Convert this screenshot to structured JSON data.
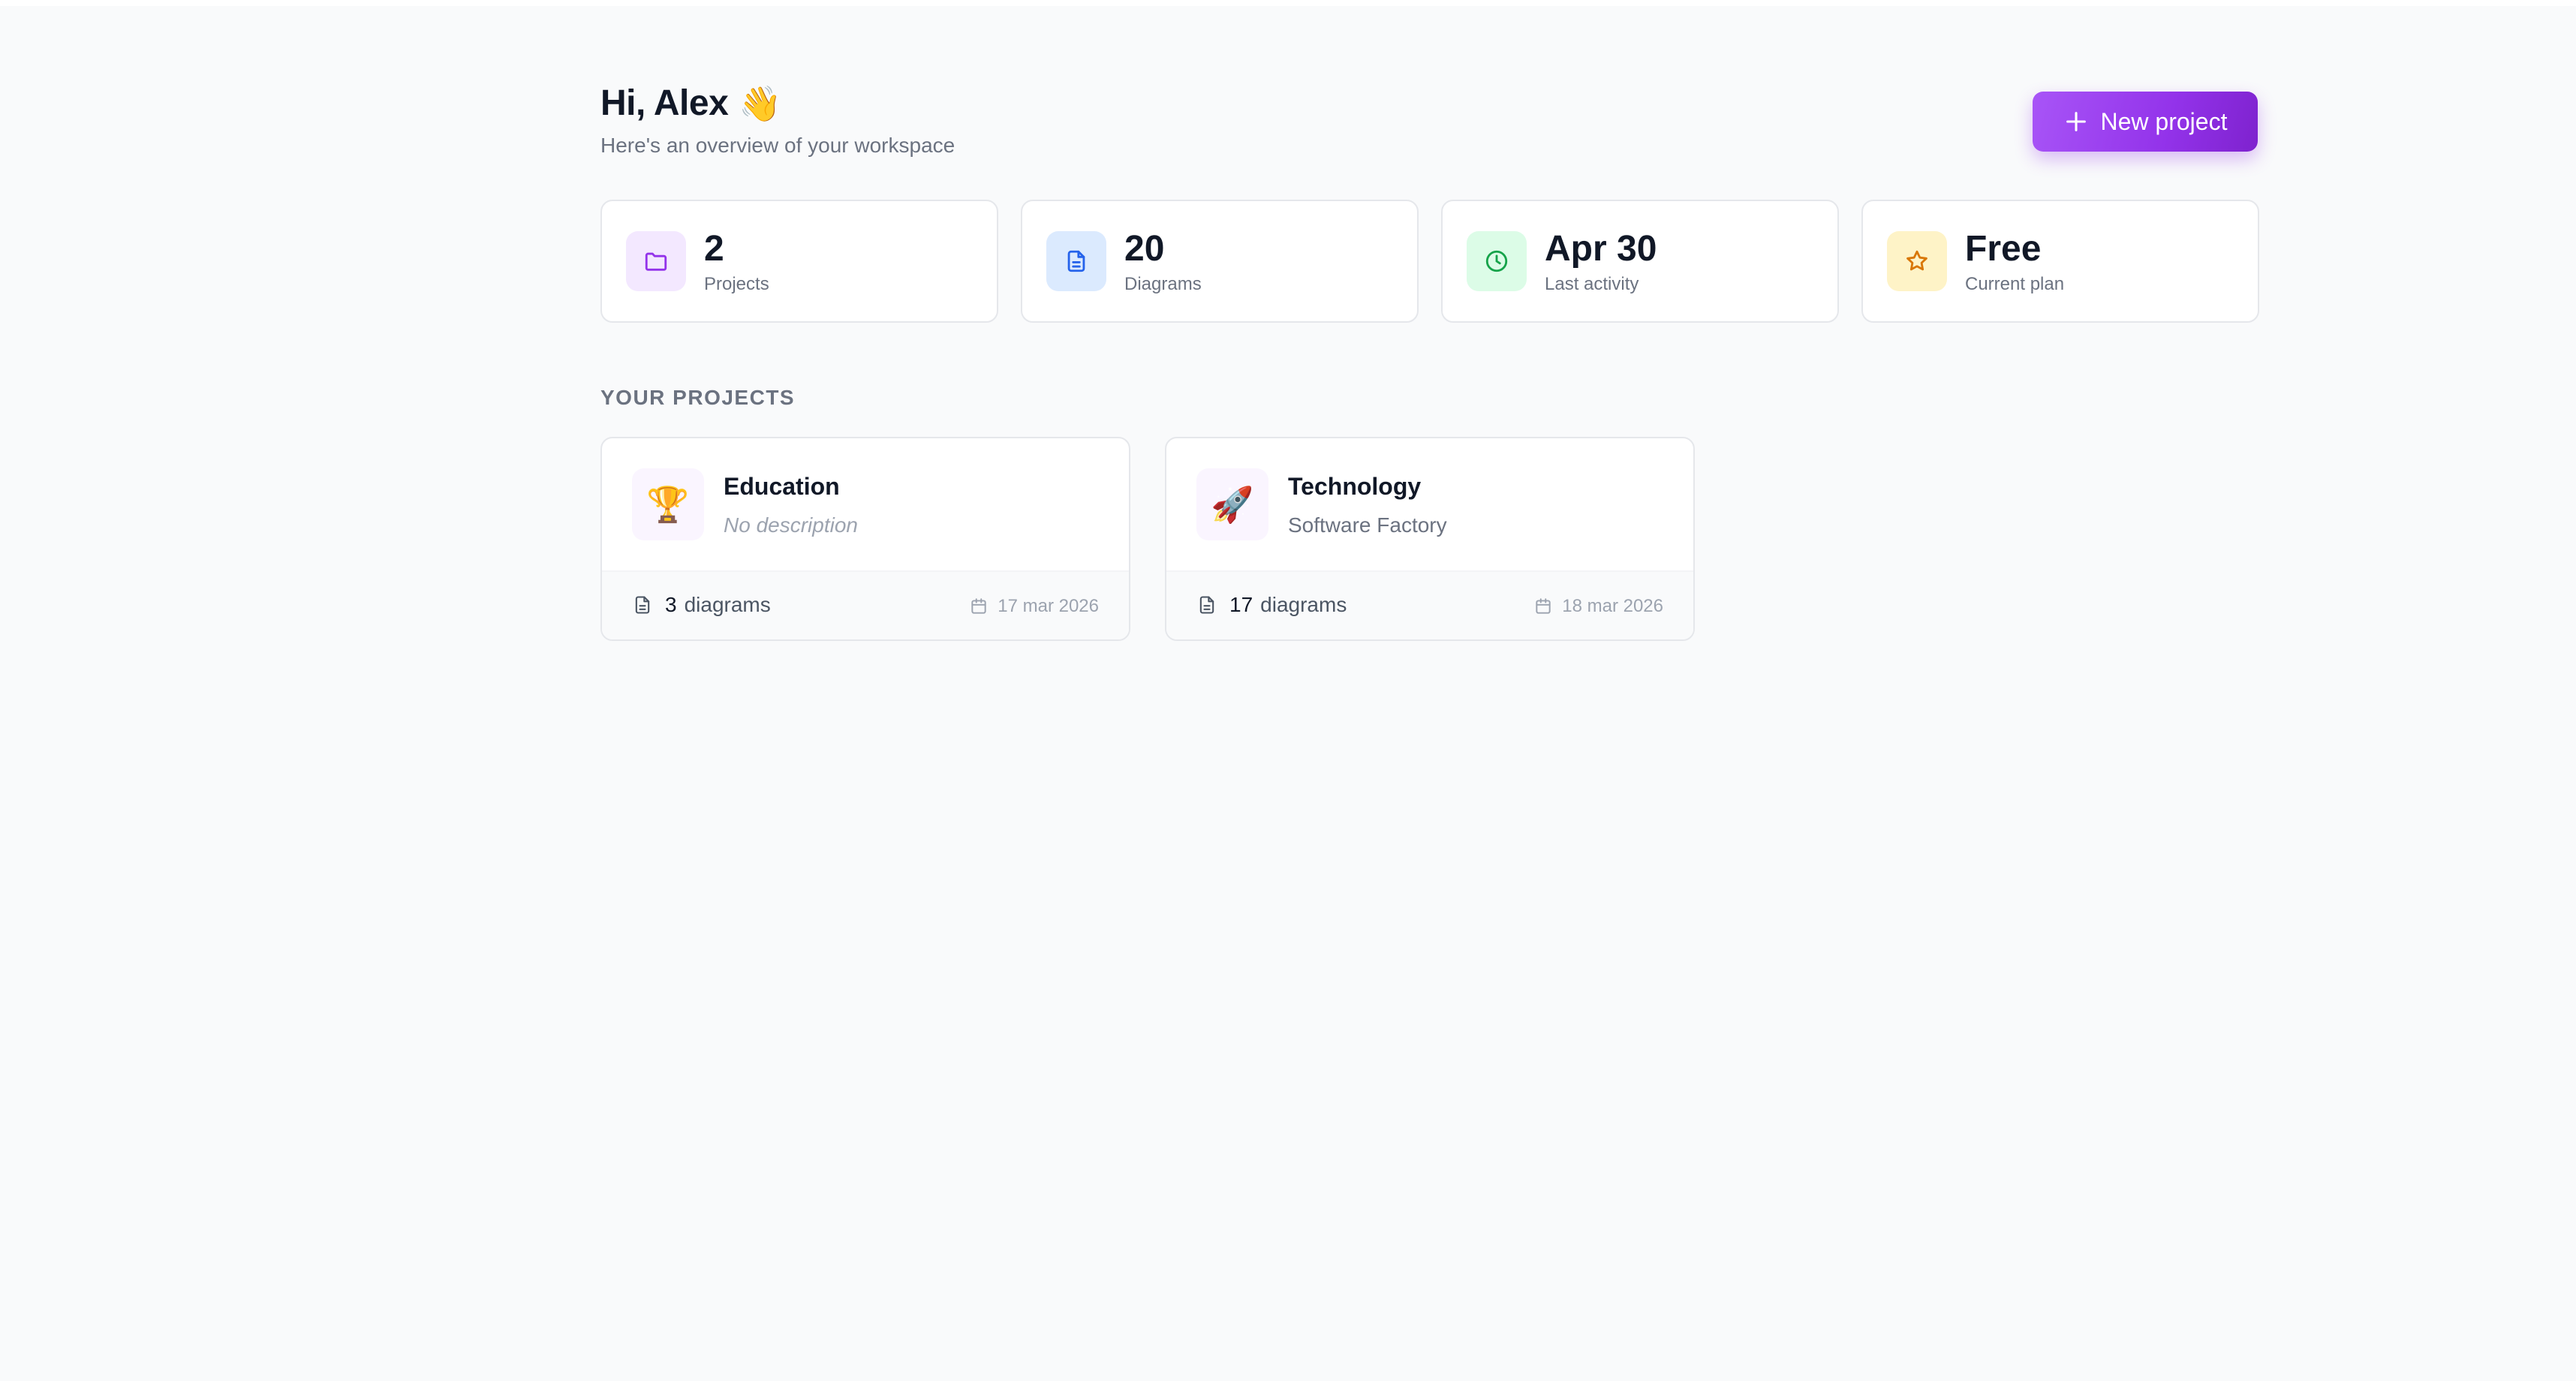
{
  "header": {
    "greeting": "Hi, Alex",
    "wave_emoji": "👋",
    "subtitle": "Here's an overview of your workspace",
    "new_project_label": "New project"
  },
  "stats": [
    {
      "value": "2",
      "label": "Projects",
      "icon": "folder-icon",
      "color": "#9333ea",
      "bg": "#f3e8ff"
    },
    {
      "value": "20",
      "label": "Diagrams",
      "icon": "document-icon",
      "color": "#2563eb",
      "bg": "#dbeafe"
    },
    {
      "value": "Apr 30",
      "label": "Last activity",
      "icon": "clock-icon",
      "color": "#16a34a",
      "bg": "#dcfce7"
    },
    {
      "value": "Free",
      "label": "Current plan",
      "icon": "star-icon",
      "color": "#d97706",
      "bg": "#fef3c7"
    }
  ],
  "projects_section": {
    "title": "YOUR PROJECTS",
    "items": [
      {
        "name": "Education",
        "description": "No description",
        "emoji": "🏆",
        "count": "3",
        "count_label": "diagrams",
        "date": "17 mar 2026"
      },
      {
        "name": "Technology",
        "description": "Software Factory",
        "emoji": "🚀",
        "count": "17",
        "count_label": "diagrams",
        "date": "18 mar 2026"
      }
    ]
  },
  "colors": {
    "accent": "#9333ea",
    "background": "#f9fafb",
    "card_border": "#e5e7eb",
    "muted_text": "#6b7280"
  }
}
